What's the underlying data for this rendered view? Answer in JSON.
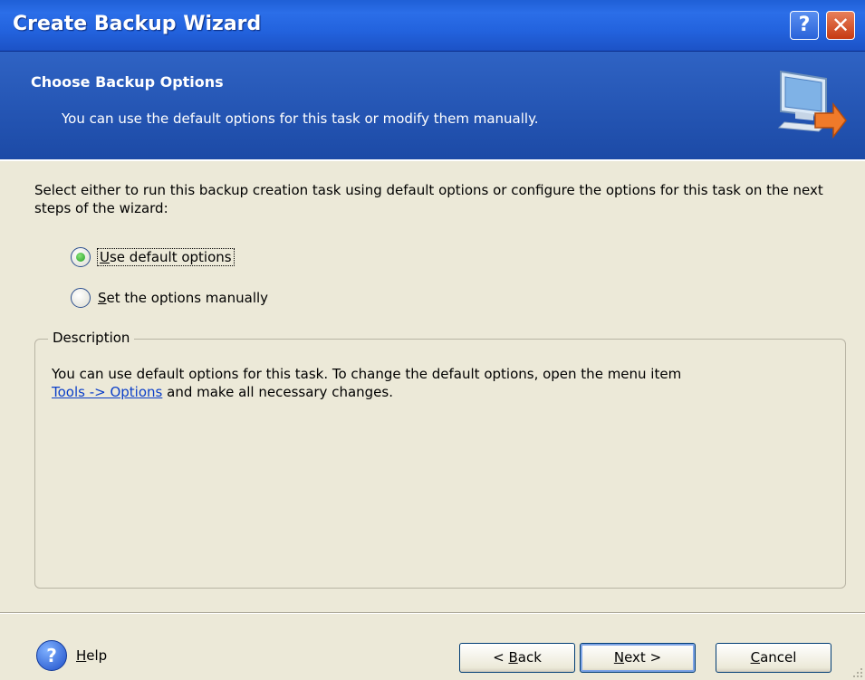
{
  "window": {
    "title": "Create Backup Wizard",
    "help_glyph": "?",
    "close_glyph": "✕"
  },
  "header": {
    "title": "Choose Backup Options",
    "subtitle": "You can use the default options for this task or modify them manually.",
    "icon": "computer-monitor-arrow-icon"
  },
  "main": {
    "intro": "Select either to run this backup creation task using default options or configure the options for this task on the next steps of the wizard:",
    "options": [
      {
        "mnemonic": "U",
        "rest": "se default options",
        "checked": true
      },
      {
        "mnemonic": "S",
        "rest": "et the options manually",
        "checked": false
      }
    ],
    "description": {
      "legend": "Description",
      "text_before": "You can use default options for this task. To change the default options, open the menu item",
      "link": "Tools -> Options",
      "text_after": "and make all necessary changes."
    }
  },
  "footer": {
    "help_mnemonic": "H",
    "help_rest": "elp",
    "back": {
      "prefix": "< ",
      "mnemonic": "B",
      "rest": "ack"
    },
    "next": {
      "mnemonic": "N",
      "rest": "ext >"
    },
    "cancel": {
      "mnemonic": "C",
      "rest": "ancel"
    }
  },
  "colors": {
    "title_bar": "#2363de",
    "header_band": "#2f63c4",
    "dialog_bg": "#ece9d8",
    "link": "#0b3fc9",
    "radio_selected": "#21a121"
  }
}
